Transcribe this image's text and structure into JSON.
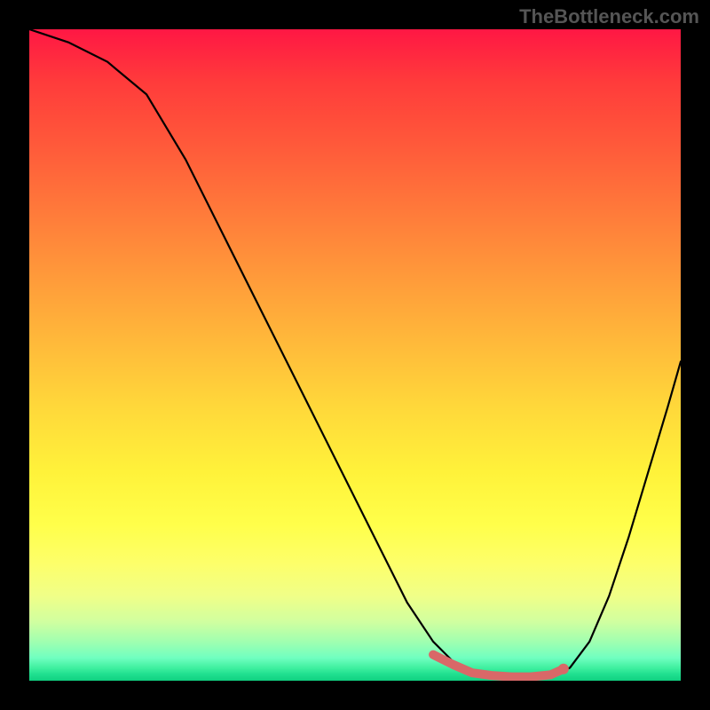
{
  "watermark": "TheBottleneck.com",
  "colors": {
    "curve": "#000000",
    "marker": "#d96868",
    "frame": "#000000"
  },
  "chart_data": {
    "type": "line",
    "title": "",
    "xlabel": "",
    "ylabel": "",
    "xlim": [
      0,
      100
    ],
    "ylim": [
      0,
      100
    ],
    "x": [
      0,
      6,
      12,
      18,
      24,
      30,
      36,
      42,
      48,
      54,
      58,
      62,
      65,
      68,
      71,
      74,
      77,
      80,
      83,
      86,
      89,
      92,
      95,
      98,
      100
    ],
    "values": [
      100,
      98,
      95,
      90,
      80,
      68,
      56,
      44,
      32,
      20,
      12,
      6,
      3,
      1,
      0.5,
      0.3,
      0.3,
      0.5,
      2,
      6,
      13,
      22,
      32,
      42,
      49
    ],
    "optimal_range": {
      "x": [
        62,
        65,
        68,
        71,
        74,
        77,
        80,
        82
      ],
      "values": [
        4,
        2.5,
        1.2,
        0.8,
        0.6,
        0.6,
        0.9,
        1.8
      ]
    },
    "optimal_point": {
      "x": 82,
      "y": 1.8
    }
  }
}
